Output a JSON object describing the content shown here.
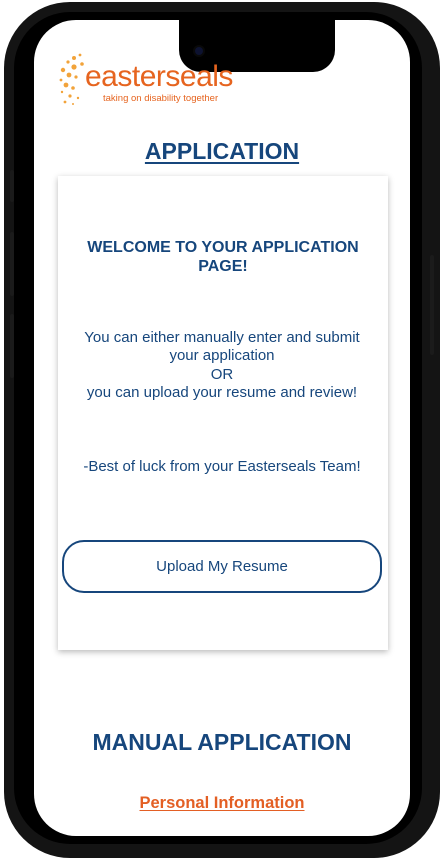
{
  "logo": {
    "name": "easterseals",
    "tagline": "taking on disability together",
    "color": "#e6641f"
  },
  "page_title": "APPLICATION",
  "card": {
    "heading": "WELCOME TO YOUR APPLICATION PAGE!",
    "line1": "You can either manually enter and submit your application",
    "line2": "OR",
    "line3": "you can upload your resume and review!",
    "sign_off": "-Best of luck from your Easterseals Team!",
    "upload_button": "Upload My Resume"
  },
  "manual_title": "MANUAL APPLICATION",
  "section_link": "Personal Information",
  "colors": {
    "primary_text": "#16467c",
    "accent": "#e35f24",
    "background": "#ffffff"
  }
}
